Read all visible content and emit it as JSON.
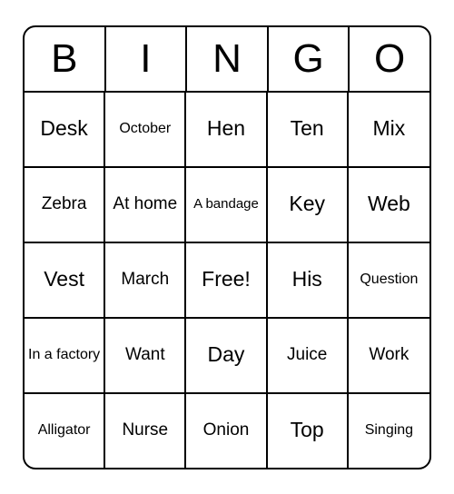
{
  "header": [
    "B",
    "I",
    "N",
    "G",
    "O"
  ],
  "grid": [
    [
      {
        "text": "Desk",
        "size": "large"
      },
      {
        "text": "October",
        "size": "small"
      },
      {
        "text": "Hen",
        "size": "large"
      },
      {
        "text": "Ten",
        "size": "large"
      },
      {
        "text": "Mix",
        "size": "large"
      }
    ],
    [
      {
        "text": "Zebra",
        "size": "med"
      },
      {
        "text": "At home",
        "size": "med"
      },
      {
        "text": "A bandage",
        "size": "xsmall"
      },
      {
        "text": "Key",
        "size": "large"
      },
      {
        "text": "Web",
        "size": "large"
      }
    ],
    [
      {
        "text": "Vest",
        "size": "large"
      },
      {
        "text": "March",
        "size": "med"
      },
      {
        "text": "Free!",
        "size": "large"
      },
      {
        "text": "His",
        "size": "large"
      },
      {
        "text": "Question",
        "size": "small"
      }
    ],
    [
      {
        "text": "In a factory",
        "size": "small"
      },
      {
        "text": "Want",
        "size": "med"
      },
      {
        "text": "Day",
        "size": "large"
      },
      {
        "text": "Juice",
        "size": "med"
      },
      {
        "text": "Work",
        "size": "med"
      }
    ],
    [
      {
        "text": "Alligator",
        "size": "small"
      },
      {
        "text": "Nurse",
        "size": "med"
      },
      {
        "text": "Onion",
        "size": "med"
      },
      {
        "text": "Top",
        "size": "large"
      },
      {
        "text": "Singing",
        "size": "small"
      }
    ]
  ]
}
